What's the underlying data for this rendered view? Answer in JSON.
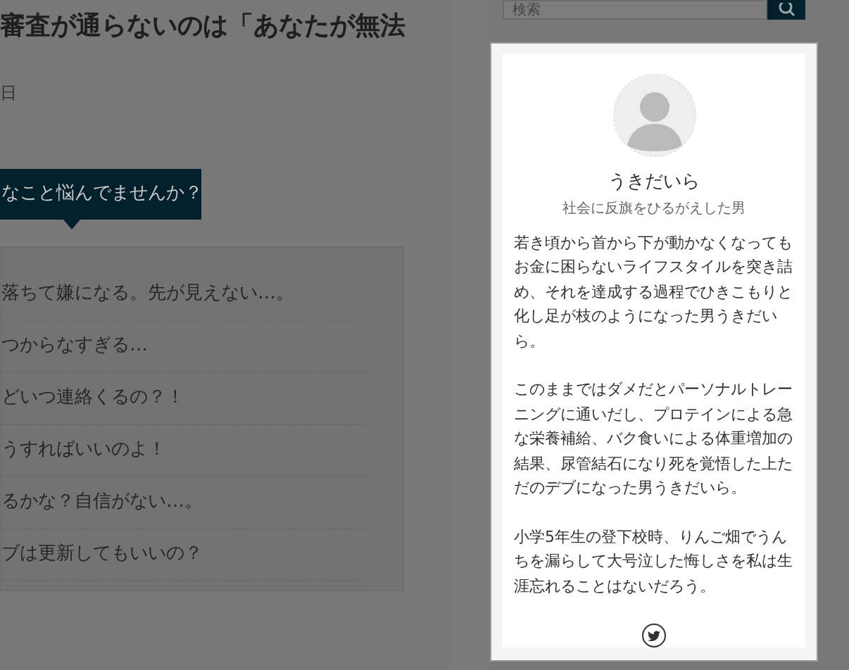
{
  "article": {
    "title": "審査が通らないのは「あなたが無法",
    "date": "日",
    "banner": "なこと悩んでませんか？",
    "worries": [
      "落ちて嫌になる。先が見えない…。",
      "つからなすぎる…",
      "どいつ連絡くるの？！",
      "うすればいいのよ！",
      "るかな？自信がない…。",
      "ブは更新してもいいの？"
    ]
  },
  "search": {
    "placeholder": "検索"
  },
  "profile": {
    "name": "うきだいら",
    "tagline": "社会に反旗をひるがえした男",
    "paragraphs": [
      "若き頃から首から下が動かなくなってもお金に困らないライフスタイルを突き詰め、それを達成する過程でひきこもりと化し足が枝のようになった男うきだいら。",
      "このままではダメだとパーソナルトレーニングに通いだし、プロテインによる急な栄養補給、バク食いによる体重増加の結果、尿管結石になり死を覚悟した上ただのデブになった男うきだいら。",
      "小学5年生の登下校時、りんご畑でうんちを漏らして大号泣した悔しさを私は生涯忘れることはないだろう。"
    ]
  }
}
